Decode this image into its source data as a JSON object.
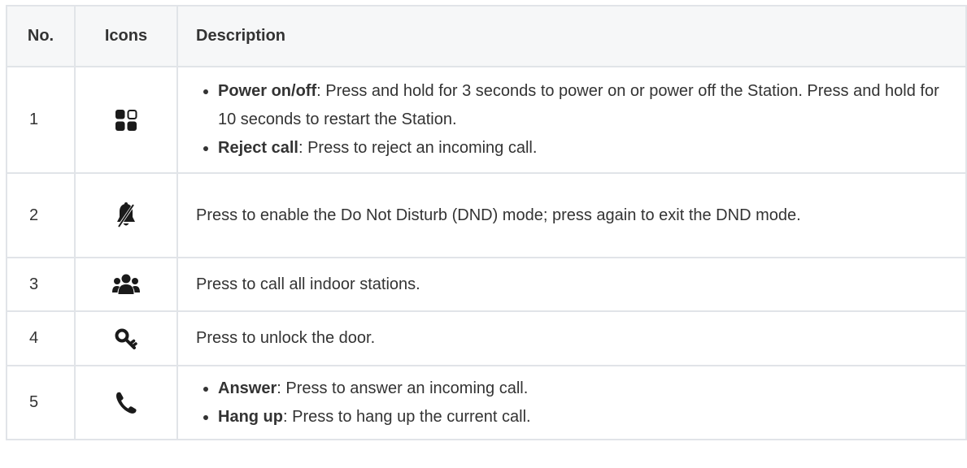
{
  "table": {
    "headers": {
      "no": "No.",
      "icons": "Icons",
      "description": "Description"
    },
    "rows": [
      {
        "no": "1",
        "icon": "apps-grid-icon",
        "items": [
          {
            "term": "Power on/off",
            "text": ": Press and hold for 3 seconds to power on or power off the Station. Press and hold for 10 seconds to restart the Station."
          },
          {
            "term": "Reject call",
            "text": ": Press to reject an incoming call."
          }
        ]
      },
      {
        "no": "2",
        "icon": "bell-slash-icon",
        "text": "Press to enable the Do Not Disturb (DND) mode; press again to exit the DND mode."
      },
      {
        "no": "3",
        "icon": "users-group-icon",
        "text": "Press to call all indoor stations."
      },
      {
        "no": "4",
        "icon": "key-icon",
        "text": "Press to unlock the door."
      },
      {
        "no": "5",
        "icon": "phone-icon",
        "items": [
          {
            "term": "Answer",
            "text": ": Press to answer an incoming call."
          },
          {
            "term": "Hang up",
            "text": ": Press to hang up the current call."
          }
        ]
      }
    ]
  },
  "colors": {
    "text": "#333333",
    "border": "#e1e4e8",
    "header_bg": "#f6f7f8",
    "icon": "#1a1a1a"
  }
}
